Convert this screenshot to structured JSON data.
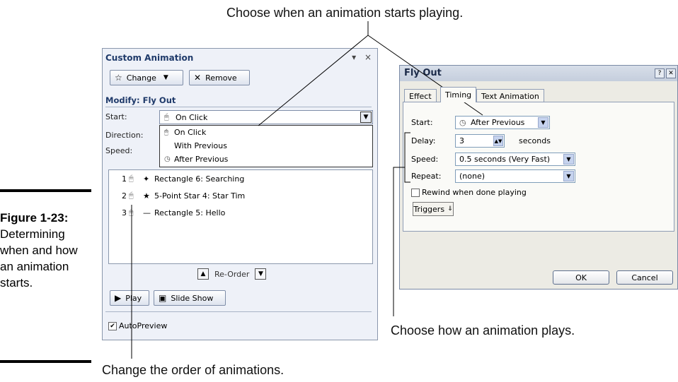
{
  "callouts": {
    "start": "Choose when an animation starts playing.",
    "timing": "Choose how an animation plays.",
    "order": "Change the order of animations."
  },
  "figure": {
    "number": "Figure 1-23:",
    "caption": "Determining when and how an animation starts."
  },
  "custom_animation": {
    "title": "Custom Animation",
    "pane_menu_icon": "dropdown-icon",
    "close_glyph": "×",
    "change_button": "Change",
    "remove_button": "Remove",
    "modify_heading": "Modify: Fly Out",
    "start_label": "Start:",
    "direction_label": "Direction:",
    "speed_label": "Speed:",
    "start_value": "On Click",
    "start_options": [
      "On Click",
      "With Previous",
      "After Previous"
    ],
    "animations": [
      {
        "num": "1",
        "name": "Rectangle 6: Searching",
        "effect_icon": "fly-effect-icon"
      },
      {
        "num": "2",
        "name": "5-Point Star 4: Star Tim",
        "effect_icon": "star-effect-icon"
      },
      {
        "num": "3",
        "name": "Rectangle 5: Hello",
        "effect_icon": "line-effect-icon"
      }
    ],
    "reorder_label": "Re-Order",
    "play_button": "Play",
    "slideshow_button": "Slide Show",
    "autopreview_label": "AutoPreview",
    "autopreview_checked": true
  },
  "fly_out": {
    "title": "Fly Out",
    "help_glyph": "?",
    "tabs": [
      "Effect",
      "Timing",
      "Text Animation"
    ],
    "active_tab": "Timing",
    "start_label": "Start:",
    "start_value": "After Previous",
    "delay_label": "Delay:",
    "delay_value": "3",
    "delay_unit": "seconds",
    "speed_label": "Speed:",
    "speed_value": "0.5 seconds (Very Fast)",
    "repeat_label": "Repeat:",
    "repeat_value": "(none)",
    "rewind_label": "Rewind when done playing",
    "rewind_checked": false,
    "triggers_button": "Triggers",
    "ok_button": "OK",
    "cancel_button": "Cancel"
  }
}
